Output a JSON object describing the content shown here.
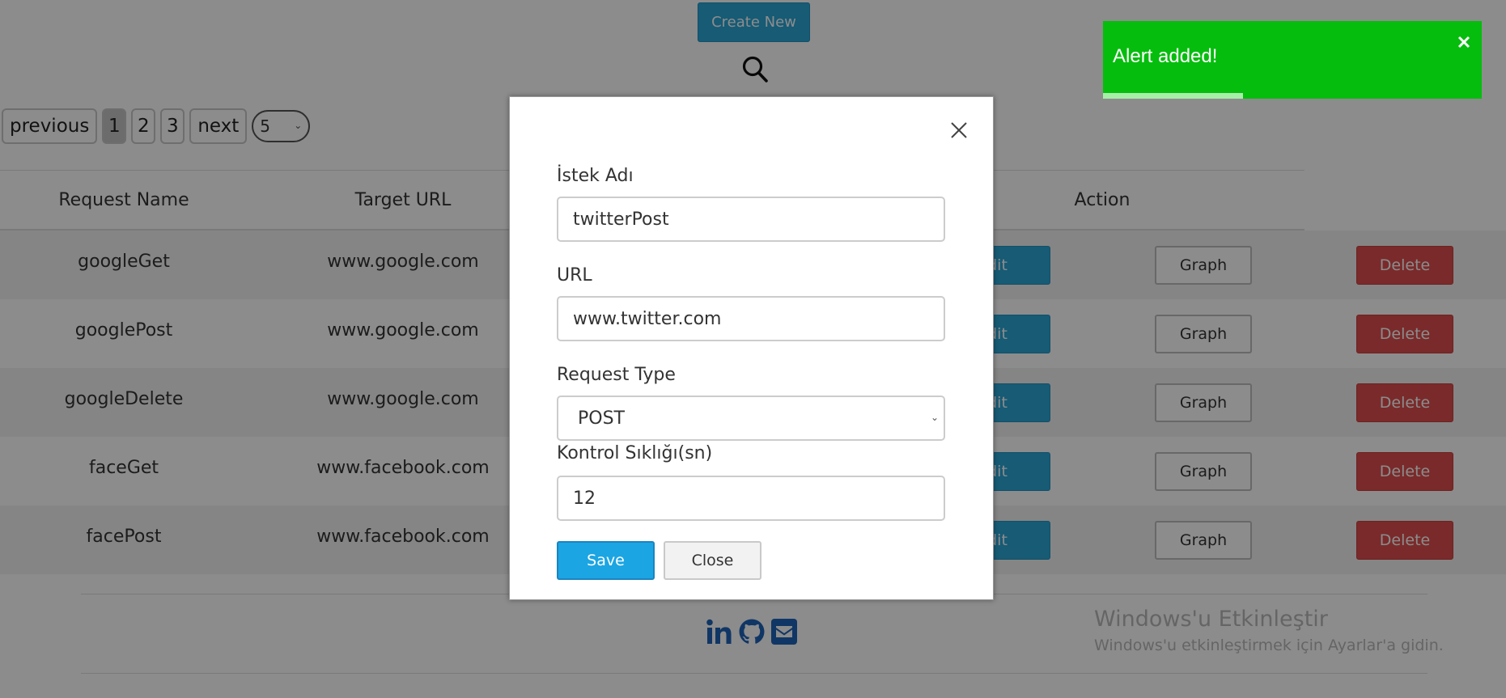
{
  "toolbar": {
    "create_label": "Create New"
  },
  "pagination": {
    "previous_label": "previous",
    "pages": [
      "1",
      "2",
      "3"
    ],
    "active_page": "1",
    "next_label": "next",
    "page_size": "5"
  },
  "table": {
    "headers": [
      "Request Name",
      "Target URL",
      "Action"
    ],
    "rows": [
      {
        "name": "googleGet",
        "url": "www.google.com",
        "edit": "Edit",
        "graph": "Graph",
        "delete": "Delete"
      },
      {
        "name": "googlePost",
        "url": "www.google.com",
        "edit": "Edit",
        "graph": "Graph",
        "delete": "Delete"
      },
      {
        "name": "googleDelete",
        "url": "www.google.com",
        "edit": "Edit",
        "graph": "Graph",
        "delete": "Delete"
      },
      {
        "name": "faceGet",
        "url": "www.facebook.com",
        "edit": "Edit",
        "graph": "Graph",
        "delete": "Delete"
      },
      {
        "name": "facePost",
        "url": "www.facebook.com",
        "edit": "Edit",
        "graph": "Graph",
        "delete": "Delete"
      }
    ]
  },
  "footer": {
    "icons": [
      "linkedin-icon",
      "github-icon",
      "mail-icon"
    ]
  },
  "watermark": {
    "title": "Windows'u Etkinleştir",
    "subtitle": "Windows'u etkinleştirmek için Ayarlar'a gidin."
  },
  "modal": {
    "name_label": "İstek Adı",
    "name_value": "twitterPost",
    "url_label": "URL",
    "url_value": "www.twitter.com",
    "type_label": "Request Type",
    "type_value": "POST",
    "interval_label": "Kontrol Sıklığı(sn)",
    "interval_value": "12",
    "save_label": "Save",
    "close_label": "Close"
  },
  "toast": {
    "message": "Alert added!",
    "progress": 0.37,
    "color": "#05bd0d"
  },
  "colors": {
    "primary": "#2aa6d6",
    "danger": "#de4e4e",
    "save": "#1ba5e3",
    "social": "#1e63b8"
  }
}
